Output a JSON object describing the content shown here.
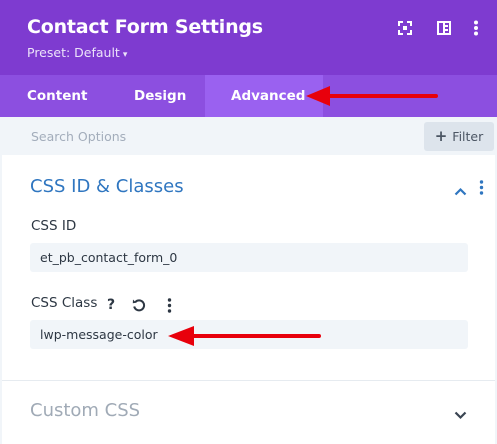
{
  "header": {
    "title": "Contact Form Settings",
    "preset_label": "Preset: Default",
    "preset_caret": "▾",
    "icons": [
      "fullscreen-icon",
      "sidebar-layout-icon",
      "more-vertical-icon"
    ],
    "bg_color": "#7e3bd0"
  },
  "tabs": [
    {
      "label": "Content",
      "active": false
    },
    {
      "label": "Design",
      "active": false
    },
    {
      "label": "Advanced",
      "active": true
    }
  ],
  "search": {
    "placeholder": "Search Options",
    "filter_label": "Filter",
    "filter_icon": "plus-icon"
  },
  "sections": {
    "css_id_classes": {
      "title": "CSS ID & Classes",
      "expanded": true,
      "css_id": {
        "label": "CSS ID",
        "value": "et_pb_contact_form_0"
      },
      "css_class": {
        "label": "CSS Class",
        "value": "lwp-message-color",
        "icons": [
          "help-icon",
          "reset-icon",
          "more-vertical-icon"
        ]
      }
    },
    "custom_css": {
      "title": "Custom CSS",
      "expanded": false
    }
  },
  "annotations": {
    "arrow_color": "#e8000c",
    "arrows": [
      "arrow-to-advanced-tab",
      "arrow-to-css-class-field"
    ]
  },
  "colors": {
    "tab_bar": "#8c4fe0",
    "active_tab": "#9a61f0",
    "section_title": "#2f76c0"
  }
}
